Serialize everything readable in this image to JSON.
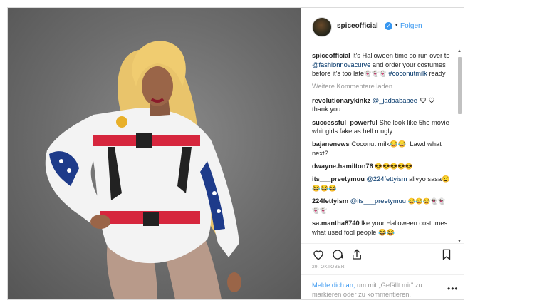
{
  "post": {
    "author": "spiceofficial",
    "verified_icon": "verified-badge-icon",
    "separator": "•",
    "follow_label": "Folgen",
    "caption": {
      "user": "spiceofficial",
      "text_1": "It's Halloween time so run over to ",
      "mention": "@fashionnovacurve",
      "text_2": " and order your costumes before it's too late",
      "emoji": "👻👻👻",
      "hashtag": "#coconutmilk",
      "text_3": " ready"
    },
    "load_more": "Weitere Kommentare laden",
    "comments": [
      {
        "user": "revolutionarykinkz",
        "mention": "@_jadaababee",
        "text": "thank you"
      },
      {
        "user": "successful_powerful",
        "text": "She look like 5he movie whit girls fake as hell n ugly"
      },
      {
        "user": "bajanenews",
        "text": "Coconut milk😂😂! Lawd what next?"
      },
      {
        "user": "dwayne.hamilton76",
        "text": "😎😎😎😎😎"
      },
      {
        "user": "its___preetymuu",
        "mention": "@224fettyism",
        "text": "alivyo sasa😧😂😂😂"
      },
      {
        "user": "224fettyism",
        "mention": "@its___preetymuu",
        "text": "😂😂😂👻👻👻👻"
      },
      {
        "user": "sa.mantha8740",
        "text": "lke your Halloween costumes what used fool people 😂😂"
      }
    ],
    "actions": {
      "like_icon": "heart-icon",
      "comment_icon": "comment-icon",
      "share_icon": "share-icon",
      "save_icon": "bookmark-icon"
    },
    "date": "29. OKTOBER",
    "login_prompt": {
      "link": "Melde dich an,",
      "text": " um mit „Gefällt mir\" zu markieren oder zu kommentieren."
    },
    "more_icon": "more-options-icon",
    "more_label": "•••"
  }
}
